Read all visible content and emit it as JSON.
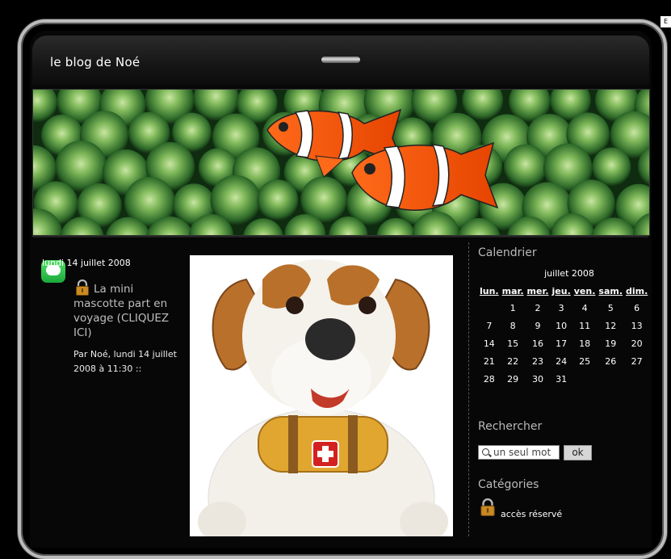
{
  "blog": {
    "title": "le blog de Noé",
    "corner_label": "E"
  },
  "post": {
    "date": "lundi 14 juillet 2008",
    "title_lines": [
      "La mini",
      "mascotte part en",
      "voyage (CLIQUEZ",
      "ICI)"
    ],
    "meta_lines": [
      "Par Noé, lundi 14 juillet",
      "2008 à 11:30 ::"
    ],
    "icon": "chat-bubble-icon",
    "lock_icon": "padlock-icon"
  },
  "sidebar": {
    "calendar": {
      "heading": "Calendrier",
      "month": "juillet 2008",
      "weekdays": [
        "lun.",
        "mar.",
        "mer.",
        "jeu.",
        "ven.",
        "sam.",
        "dim."
      ],
      "weeks": [
        [
          "",
          "1",
          "2",
          "3",
          "4",
          "5",
          "6"
        ],
        [
          "7",
          "8",
          "9",
          "10",
          "11",
          "12",
          "13"
        ],
        [
          "14",
          "15",
          "16",
          "17",
          "18",
          "19",
          "20"
        ],
        [
          "21",
          "22",
          "23",
          "24",
          "25",
          "26",
          "27"
        ],
        [
          "28",
          "29",
          "30",
          "31",
          "",
          "",
          ""
        ]
      ]
    },
    "search": {
      "heading": "Rechercher",
      "value": "un seul mot",
      "button": "ok"
    },
    "categories": {
      "heading": "Catégories",
      "items": [
        "accès réservé"
      ]
    }
  },
  "colors": {
    "background": "#000000",
    "frame": "#bcbcbc",
    "sidebar_heading": "#b9b9b9",
    "post_title": "#bfbfbf"
  }
}
